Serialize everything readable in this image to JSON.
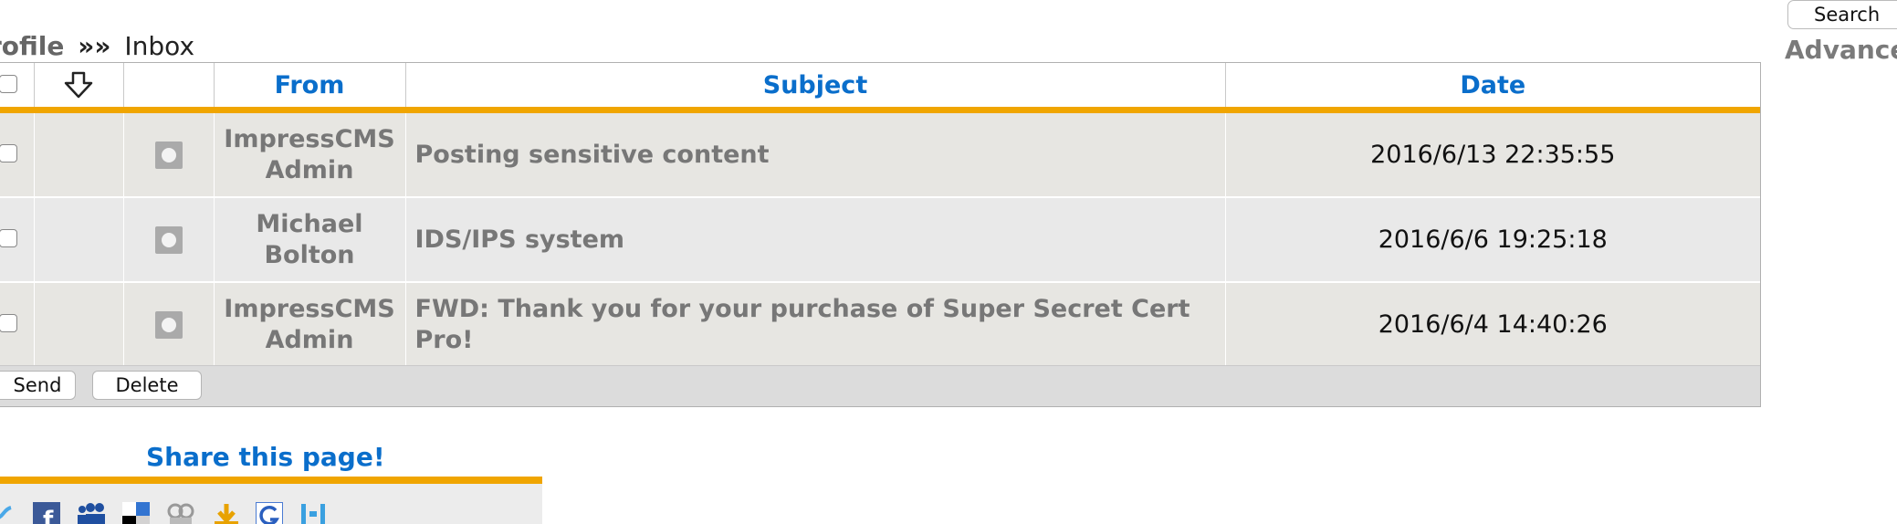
{
  "header": {
    "search_button": "Search",
    "advanced_label": "Advance",
    "breadcrumb": {
      "link": "rofile",
      "separator": "»»",
      "current": "Inbox"
    }
  },
  "inbox": {
    "columns": {
      "from": "From",
      "subject": "Subject",
      "date": "Date"
    },
    "rows": [
      {
        "from_line1": "ImpressCMS",
        "from_line2": "Admin",
        "subject": "Posting sensitive content",
        "date": "2016/6/13 22:35:55"
      },
      {
        "from_line1": "Michael",
        "from_line2": "Bolton",
        "subject": "IDS/IPS system",
        "date": "2016/6/6 19:25:18"
      },
      {
        "from_line1": "ImpressCMS",
        "from_line2": "Admin",
        "subject": "FWD: Thank you for your purchase of Super Secret Cert Pro!",
        "date": "2016/6/4 14:40:26"
      }
    ],
    "actions": {
      "send": "Send",
      "delete": "Delete"
    }
  },
  "share": {
    "title": "Share this page!",
    "icons": [
      "twitter-icon",
      "facebook-icon",
      "myspace-icon",
      "delicious-icon",
      "digg-icon",
      "stumbleupon-icon",
      "google-icon",
      "linkedin-icon"
    ]
  },
  "colors": {
    "accent_blue": "#0a6ecb",
    "accent_orange": "#f0a500"
  }
}
